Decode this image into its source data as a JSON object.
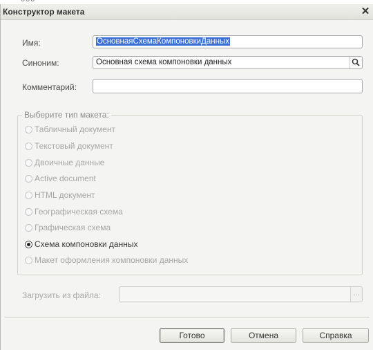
{
  "window": {
    "title": "Конструктор макета",
    "close_glyph": "✕"
  },
  "fields": {
    "name_label": "Имя:",
    "name_value": "ОсновнаяСхемаКомпоновкиДанных",
    "synonym_label": "Синоним:",
    "synonym_value": "Основная схема компоновки данных",
    "comment_label": "Комментарий:",
    "comment_value": ""
  },
  "template_type": {
    "legend": "Выберите тип макета:",
    "options": [
      {
        "label": "Табличный документ",
        "selected": false,
        "enabled": false
      },
      {
        "label": "Текстовый документ",
        "selected": false,
        "enabled": false
      },
      {
        "label": "Двоичные данные",
        "selected": false,
        "enabled": false
      },
      {
        "label": "Active document",
        "selected": false,
        "enabled": false
      },
      {
        "label": "HTML документ",
        "selected": false,
        "enabled": false
      },
      {
        "label": "Географическая схема",
        "selected": false,
        "enabled": false
      },
      {
        "label": "Графическая схема",
        "selected": false,
        "enabled": false
      },
      {
        "label": "Схема компоновки данных",
        "selected": true,
        "enabled": true
      },
      {
        "label": "Макет оформления компоновки данных",
        "selected": false,
        "enabled": false
      }
    ]
  },
  "load_from_file": {
    "label": "Загрузить из файла:",
    "value": "",
    "browse_glyph": "..."
  },
  "buttons": {
    "ok": "Готово",
    "cancel": "Отмена",
    "help": "Справка"
  },
  "icons": {
    "search": "search-icon",
    "close": "close-icon",
    "browse": "ellipsis-icon"
  }
}
